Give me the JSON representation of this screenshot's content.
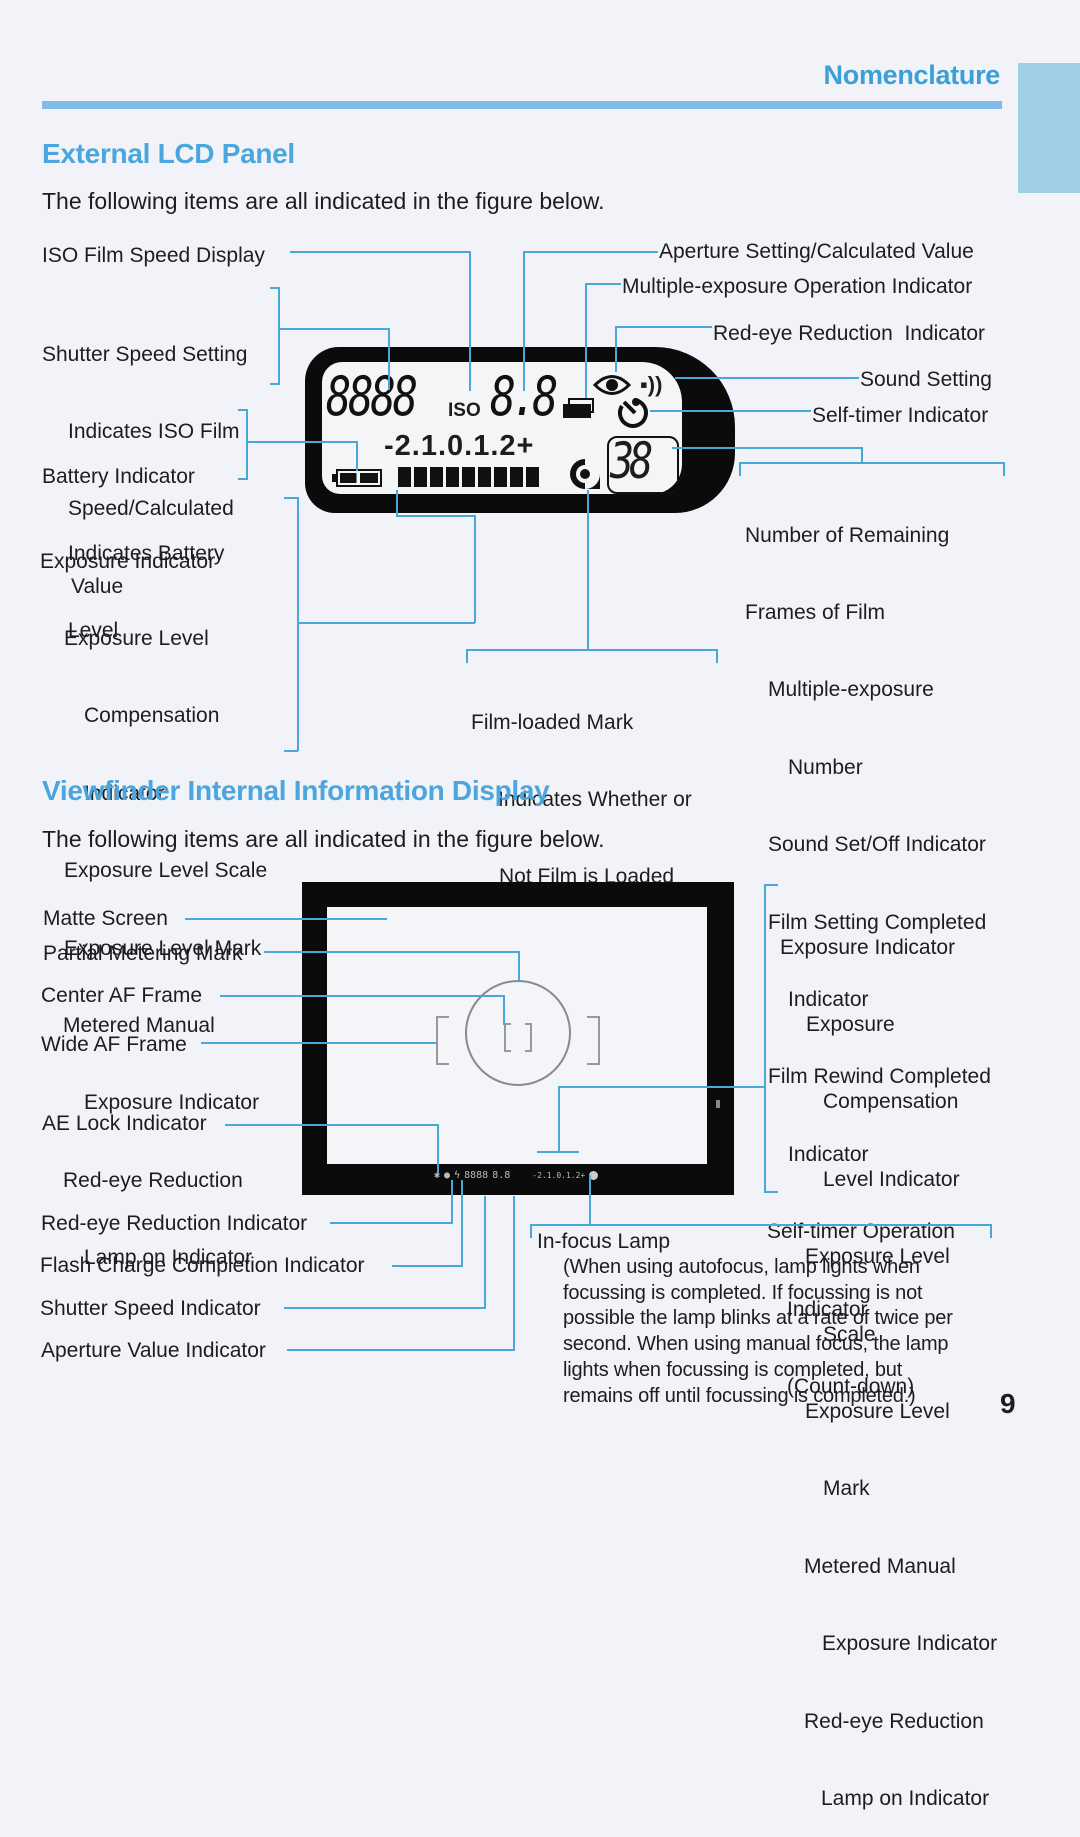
{
  "header": {
    "section": "Nomenclature",
    "accent_color": "#3aa0d6",
    "page_number": "9"
  },
  "lcd_section": {
    "title": "External LCD Panel",
    "intro": "The following items are all indicated in the figure below.",
    "display": {
      "shutter_digits": "8888",
      "iso_label": "ISO",
      "aperture_digits": "8.8",
      "exposure_scale": "-2.1.0.1.2+",
      "frame_counter": "38",
      "exposure_bars": 9
    },
    "left_labels": [
      {
        "lines": [
          "ISO Film Speed Display"
        ]
      },
      {
        "lines": [
          "Shutter Speed Setting",
          "Indicates ISO Film",
          "Speed/Calculated",
          "Value"
        ]
      },
      {
        "lines": [
          "Battery Indicator",
          "Indicates Battery",
          "Level"
        ]
      },
      {
        "lines": [
          "Exposure Indicator",
          "Exposure Level",
          "Compensation",
          "Indicator",
          "Exposure Level Scale",
          "Exposure Level Mark",
          "Metered Manual",
          "Exposure Indicator",
          "Red-eye Reduction",
          "Lamp on Indicator"
        ]
      }
    ],
    "right_labels": [
      "Aperture Setting/Calculated Value",
      "Multiple-exposure Operation Indicator",
      "Red-eye Reduction  Indicator",
      "Sound Setting",
      "Self-timer Indicator"
    ],
    "frames_block": {
      "lines": [
        "Number of Remaining",
        "Frames of Film",
        "Multiple-exposure",
        "Number",
        "Sound Set/Off Indicator",
        "Film Setting Completed",
        "Indicator",
        "Film Rewind Completed",
        "Indicator",
        "Self-timer Operation",
        "Indicator",
        "(Count-down)"
      ]
    },
    "film_loaded_block": {
      "lines": [
        "Film-loaded Mark",
        "Indicates Whether or",
        "Not Film is Loaded"
      ]
    }
  },
  "viewfinder_section": {
    "title": "Viewfinder Internal Information Display",
    "intro": "The following items are all indicated in the figure below.",
    "left_labels": [
      "Matte Screen",
      "Partial Metering Mark",
      "Center AF Frame",
      "Wide AF Frame",
      "AE Lock Indicator"
    ],
    "bottom_labels": [
      "Red-eye Reduction Indicator",
      "Flash Charge Completion Indicator",
      "Shutter Speed Indicator",
      "Aperture Value Indicator"
    ],
    "exposure_block": {
      "lines": [
        "Exposure Indicator",
        "Exposure",
        "Compensation",
        "Level Indicator",
        "Exposure Level",
        "Scale",
        "Exposure Level",
        "Mark",
        "Metered Manual",
        "Exposure Indicator",
        "Red-eye Reduction",
        "Lamp on Indicator"
      ]
    },
    "infocus_block": {
      "title": "In-focus Lamp",
      "lines": [
        "(When using autofocus, lamp lights when",
        "focussing is completed. If focussing is not",
        "possible the lamp blinks at a rate of twice per",
        "second. When using manual focus, the lamp",
        "lights when focussing is completed, but",
        "remains off until focussing is completed.)"
      ]
    },
    "vf_strip": {
      "shutter": "8888",
      "aperture": "8.8",
      "scale": "-2.1.0.1.2+"
    }
  }
}
